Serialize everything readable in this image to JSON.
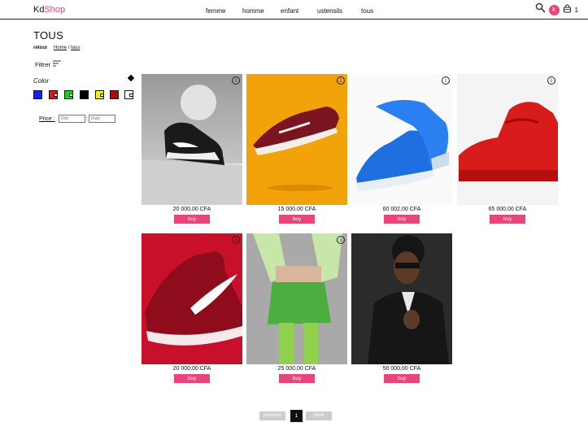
{
  "logo": {
    "part1": "Kd",
    "part2": "Shop"
  },
  "nav": [
    {
      "label": "femme"
    },
    {
      "label": "homme"
    },
    {
      "label": "enfant"
    },
    {
      "label": "ustensils"
    },
    {
      "label": "tous"
    }
  ],
  "user": {
    "avatar_letter": "k",
    "cart_count": "1"
  },
  "page": {
    "title": "TOUS"
  },
  "breadcrumb": {
    "back": "retour",
    "home": "Home",
    "separator": "/",
    "current": "tous"
  },
  "filter": {
    "label": "Filtrer"
  },
  "sidebar": {
    "color_label": "Color",
    "colors": [
      "#1424e6",
      "#e61414",
      "#1bd21b",
      "#000000",
      "#f2f214",
      "#a50f14",
      "#ffffff"
    ],
    "price_label": "Price :",
    "min_placeholder": "min",
    "max_placeholder": "max",
    "separator": ":"
  },
  "products": [
    {
      "price": "20 000,00 CFA",
      "buy": "buy",
      "image": "black-white-sneaker-photo"
    },
    {
      "price": "15 000,00 CFA",
      "buy": "buy",
      "image": "maroon-sneaker-orange-bg-photo"
    },
    {
      "price": "60 002,00 CFA",
      "buy": "buy",
      "image": "blue-running-shoes-photo"
    },
    {
      "price": "65 000,00 CFA",
      "buy": "buy",
      "image": "red-high-top-sneaker-photo"
    },
    {
      "price": "20 000,00 CFA",
      "buy": "buy",
      "image": "red-nike-running-shoe-photo"
    },
    {
      "price": "25 000,00 CFA",
      "buy": "buy",
      "image": "green-skirt-outfit-photo"
    },
    {
      "price": "50 000,00 CFA",
      "buy": "buy",
      "image": "man-in-suit-portrait-photo"
    }
  ],
  "pagination": {
    "previous": "previous",
    "current": "1",
    "next": "more"
  },
  "accent_color": "#e8457a"
}
